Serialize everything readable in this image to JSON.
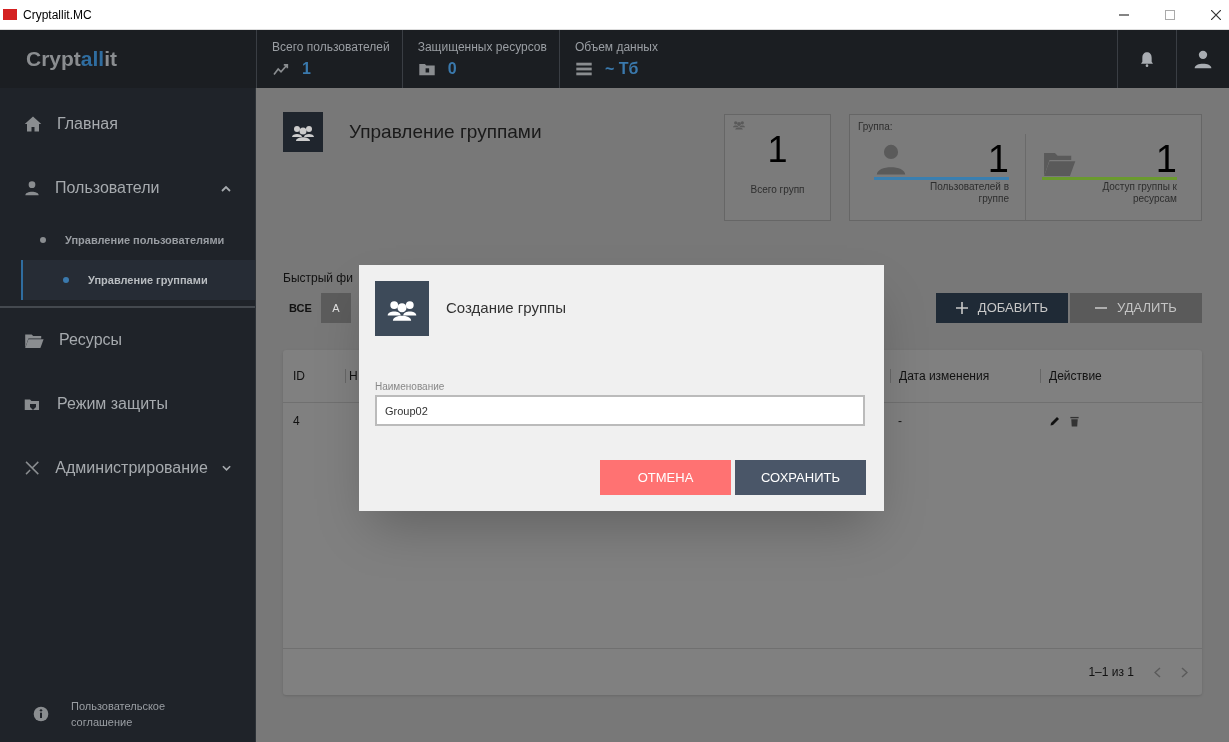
{
  "window": {
    "title": "Cryptallit.MC"
  },
  "header": {
    "logo": {
      "part1": "Crypt",
      "part2": "all",
      "part3": "it"
    },
    "stats": [
      {
        "kind": "users",
        "label": "Всего пользователей",
        "value": "1"
      },
      {
        "kind": "resources",
        "label": "Защищенных ресурсов",
        "value": "0"
      },
      {
        "kind": "data",
        "label": "Объем данных",
        "value": "~ Тб"
      }
    ]
  },
  "sidebar": {
    "items": [
      {
        "kind": "home",
        "label": "Главная"
      },
      {
        "kind": "user",
        "label": "Пользователи",
        "expanded": true,
        "children": [
          {
            "label": "Управление пользователями",
            "selected": false
          },
          {
            "label": "Управление группами",
            "selected": true
          }
        ]
      },
      {
        "kind": "folder",
        "label": "Ресурсы"
      },
      {
        "kind": "shield",
        "label": "Режим защиты"
      },
      {
        "kind": "tools",
        "label": "Администрирование",
        "expanded": false
      }
    ],
    "footer": "Пользовательское соглашение"
  },
  "page": {
    "title": "Управление группами",
    "total_card": {
      "value": "1",
      "label": "Всего групп"
    },
    "group_card": {
      "title": "Группа:",
      "metrics": [
        {
          "kind": "user",
          "value": "1",
          "label": "Пользователей в группе",
          "color": "#3a7fb0"
        },
        {
          "kind": "folder",
          "value": "1",
          "label": "Доступ группы к ресурсам",
          "color": "#6a9a2e"
        }
      ]
    },
    "filter": {
      "label": "Быстрый фи",
      "letters": [
        {
          "label": "ВСЕ",
          "selected": true
        },
        {
          "label": "А",
          "selected": false
        }
      ]
    },
    "buttons": [
      {
        "kind": "add",
        "label": "ДОБАВИТЬ",
        "disabled": false
      },
      {
        "kind": "delete",
        "label": "УДАЛИТЬ",
        "disabled": true
      }
    ],
    "table": {
      "columns": [
        "ID",
        "Н",
        "Дата изменения",
        "Действие"
      ],
      "rows": [
        {
          "id": "4",
          "date": "-"
        }
      ],
      "pagination": "1–1 из 1"
    }
  },
  "dialog": {
    "title": "Создание группы",
    "field": {
      "label": "Наименование",
      "value": "Group02"
    },
    "buttons": [
      {
        "kind": "cancel",
        "label": "ОТМЕНА"
      },
      {
        "kind": "save",
        "label": "СОХРАНИТЬ"
      }
    ]
  }
}
